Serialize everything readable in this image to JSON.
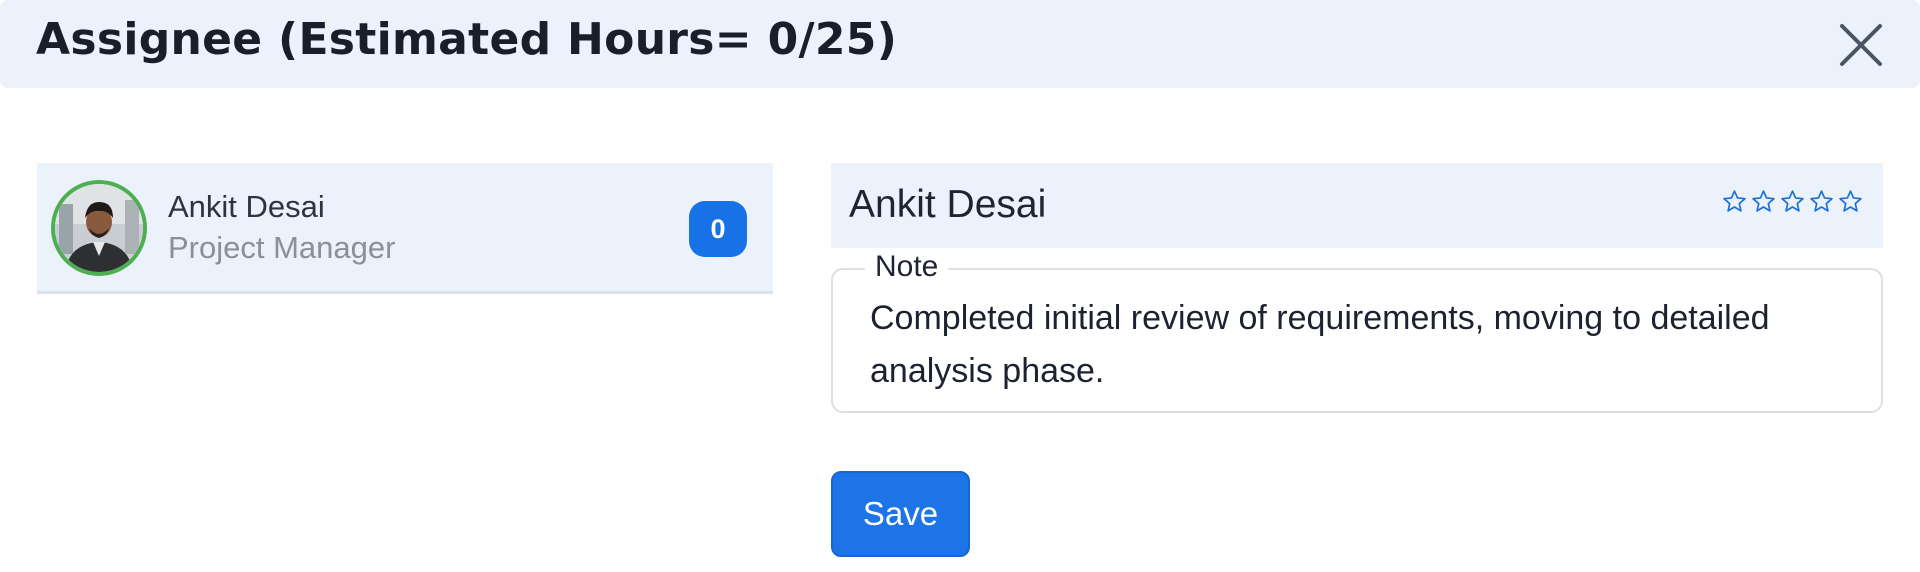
{
  "dialog": {
    "title": "Assignee (Estimated Hours= 0/25)",
    "close_icon": "close-icon"
  },
  "assignee_list": [
    {
      "name": "Ankit Desai",
      "role": "Project Manager",
      "hours": "0",
      "avatar_ring_color": "#4caf50"
    }
  ],
  "detail": {
    "name": "Ankit Desai",
    "rating": 0,
    "rating_max": 5,
    "note_label": "Note",
    "note_text": "Completed initial review of requirements, moving to detailed analysis phase.",
    "save_label": "Save"
  },
  "colors": {
    "accent": "#1672e6",
    "panel_bg": "#ebf2fc",
    "star": "#1b6fd4"
  }
}
